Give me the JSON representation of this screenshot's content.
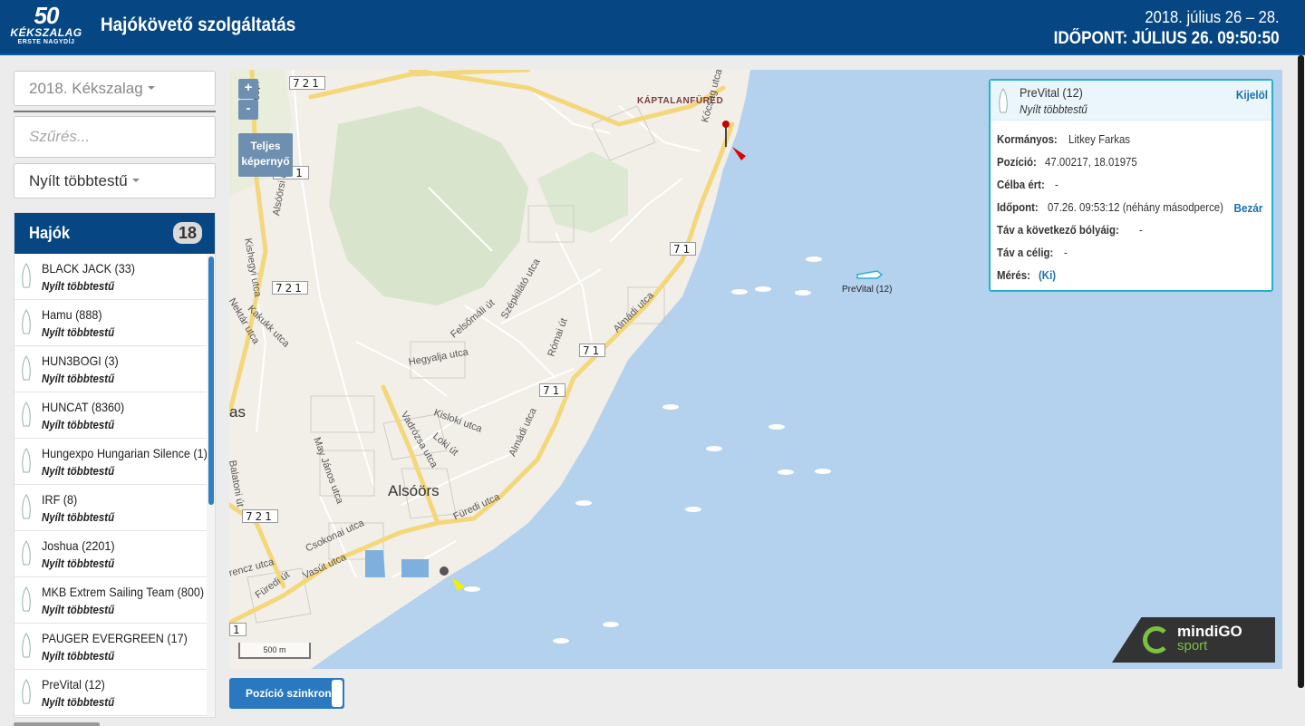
{
  "header": {
    "logo_number": "50",
    "logo_name": "KÉKSZALAG",
    "logo_sub": "ERSTE NAGYDÍJ",
    "title": "Hajókövető szolgáltatás",
    "dates": "2018. július 26 – 28.",
    "time": "IDŐPONT: JÚLIUS 26.  09:50:50"
  },
  "sidebar": {
    "event_select": "2018. Kékszalag",
    "filter_placeholder": "Szűrés...",
    "class_select": "Nyílt többtestű",
    "boats_title": "Hajók",
    "boats_count": "18",
    "boats": [
      {
        "name": "BLACK JACK (33)",
        "class": "Nyílt többtestű"
      },
      {
        "name": "Hamu (888)",
        "class": "Nyílt többtestű"
      },
      {
        "name": "HUN3BOGI (3)",
        "class": "Nyílt többtestű"
      },
      {
        "name": "HUNCAT (8360)",
        "class": "Nyílt többtestű"
      },
      {
        "name": "Hungexpo Hungarian Silence (1)",
        "class": "Nyílt többtestű"
      },
      {
        "name": "IRF (8)",
        "class": "Nyílt többtestű"
      },
      {
        "name": "Joshua (2201)",
        "class": "Nyílt többtestű"
      },
      {
        "name": "MKB Extrem Sailing Team (800)",
        "class": "Nyílt többtestű"
      },
      {
        "name": "PAUGER EVERGREEN (17)",
        "class": "Nyílt többtestű"
      },
      {
        "name": "PreVital (12)",
        "class": "Nyílt többtestű"
      }
    ]
  },
  "map": {
    "zoom_in": "+",
    "zoom_out": "-",
    "fullscreen": "Teljes képernyő",
    "scale": "500 m",
    "town": "Alsóörs",
    "town_cut": "as",
    "district": "KÁPTALANFÜRED",
    "route_721": "721",
    "route_71": "71",
    "route_1": "1",
    "boat_label": "PreVital (12)",
    "streets": {
      "kishegyi": "Kishegyi utca",
      "alsoorsi": "Alsóörsi út",
      "nektar": "Nektár utca",
      "kakukk": "Kakukk utca",
      "felsomali": "Felsőmáli út",
      "szepkilato": "Szépkilátó utca",
      "hegyalja": "Hegyalja utca",
      "romai": "Római út",
      "almadi": "Almádi utca",
      "almadi2": "Almádi utca",
      "kisloki": "Kisloki utca",
      "loki": "Loki út",
      "vadrozsa": "Vadrózsa utca",
      "may": "May János utca",
      "balatoni": "Balatoni út",
      "furedi": "Füredi utca",
      "furedi2": "Füredi út",
      "csokonai": "Csokonai utca",
      "vasut": "Vasút utca",
      "rencz": "rencz utca",
      "kocsag": "Kócsag utca",
      "alsoorsi_top": "utca"
    },
    "sponsor_a": "mindiGO",
    "sponsor_b": "sport"
  },
  "info": {
    "name": "PreVital (12)",
    "class": "Nyílt többtestű",
    "select_link": "Kijelöl",
    "close_link": "Bezár",
    "rows": [
      {
        "k": "Kormányos:",
        "v": "Litkey Farkas"
      },
      {
        "k": "Pozíció:",
        "v": "47.00217, 18.01975"
      },
      {
        "k": "Célba ért:",
        "v": "-"
      },
      {
        "k": "Időpont:",
        "v": "07.26. 09:53:12 (néhány másodperce)"
      },
      {
        "k": "Táv a következő bólyáig:",
        "v": "-"
      },
      {
        "k": "Táv a célig:",
        "v": "-"
      },
      {
        "k": "Mérés:",
        "v": "(Ki)"
      }
    ]
  },
  "controls": {
    "sync_label": "Pozíció szinkron"
  },
  "colors": {
    "brand": "#064783",
    "water": "#b4d1ee",
    "accent": "#26b0d2"
  }
}
